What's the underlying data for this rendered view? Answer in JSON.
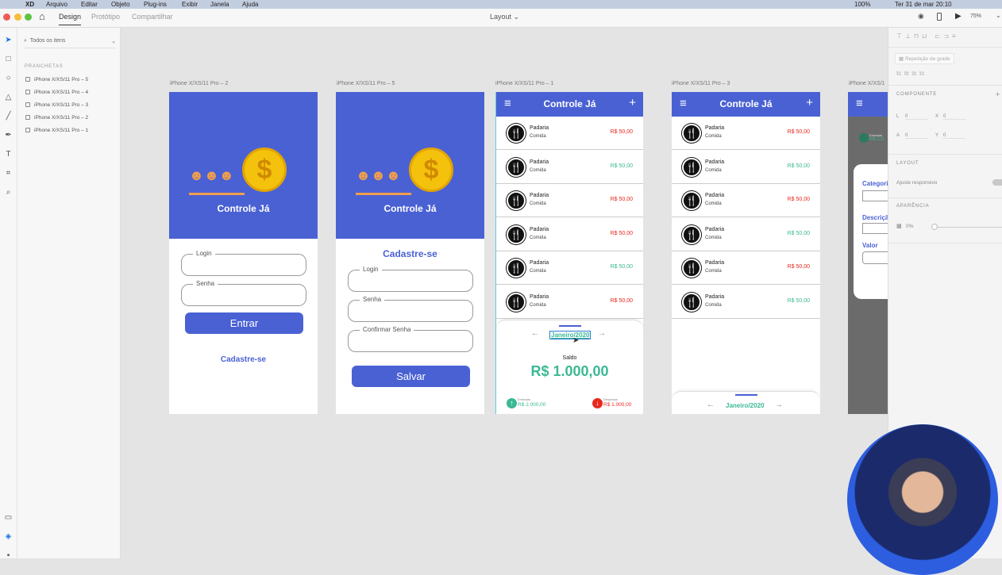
{
  "menubar": {
    "items": [
      "XD",
      "Arquivo",
      "Editar",
      "Objeto",
      "Plug-ins",
      "Exibir",
      "Janela",
      "Ajuda"
    ],
    "battery": "100%",
    "clock": "Ter 31 de mar  20:10"
  },
  "toolbar": {
    "tabs": [
      "Design",
      "Protótipo",
      "Compartilhar"
    ],
    "doc_title": "Layout",
    "zoom": "75%"
  },
  "layers": {
    "search_placeholder": "Todos os itens",
    "section": "PRANCHETAS",
    "items": [
      "iPhone X/XS/11 Pro – 5",
      "iPhone X/XS/11 Pro – 4",
      "iPhone X/XS/11 Pro – 3",
      "iPhone X/XS/11 Pro – 2",
      "iPhone X/XS/11 Pro – 1"
    ]
  },
  "artboards": {
    "login": {
      "label": "iPhone X/XS/11 Pro – 2",
      "title": "Controle Já",
      "login": "Login",
      "senha": "Senha",
      "entrar": "Entrar",
      "cadastre": "Cadastre-se"
    },
    "signup": {
      "label": "iPhone X/XS/11 Pro – 5",
      "title": "Controle Já",
      "heading": "Cadastre-se",
      "login": "Login",
      "senha": "Senha",
      "confirmar": "Confirmar Senha",
      "salvar": "Salvar"
    },
    "list1": {
      "label": "iPhone X/XS/11 Pro – 1",
      "title": "Controle Já",
      "month": "Janeiro/2020",
      "saldo_label": "Saldo",
      "saldo": "R$ 1.000,00",
      "entradas_label": "Entradas",
      "entradas": "R$ 2.000,00",
      "despesas_label": "Despesas",
      "despesas": "R$ 1.000,00",
      "rows": [
        {
          "name": "Padaria",
          "cat": "Comida",
          "amount": "R$ 50,00",
          "type": "out"
        },
        {
          "name": "Padaria",
          "cat": "Comida",
          "amount": "R$ 50,00",
          "type": "in"
        },
        {
          "name": "Padaria",
          "cat": "Comida",
          "amount": "R$ 50,00",
          "type": "out"
        },
        {
          "name": "Padaria",
          "cat": "Comida",
          "amount": "R$ 50,00",
          "type": "out"
        },
        {
          "name": "Padaria",
          "cat": "Comida",
          "amount": "R$ 50,00",
          "type": "in"
        },
        {
          "name": "Padaria",
          "cat": "Comida",
          "amount": "R$ 50,00",
          "type": "out"
        }
      ]
    },
    "list3": {
      "label": "iPhone X/XS/11 Pro – 3",
      "title": "Controle Já",
      "month": "Janeiro/2020",
      "rows": [
        {
          "name": "Padaria",
          "cat": "Comida",
          "amount": "R$ 50,00",
          "type": "out"
        },
        {
          "name": "Padaria",
          "cat": "Comida",
          "amount": "R$ 50,00",
          "type": "in"
        },
        {
          "name": "Padaria",
          "cat": "Comida",
          "amount": "R$ 50,00",
          "type": "out"
        },
        {
          "name": "Padaria",
          "cat": "Comida",
          "amount": "R$ 50,00",
          "type": "in"
        },
        {
          "name": "Padaria",
          "cat": "Comida",
          "amount": "R$ 50,00",
          "type": "out"
        },
        {
          "name": "Padaria",
          "cat": "Comida",
          "amount": "R$ 50,00",
          "type": "in"
        }
      ]
    },
    "form4": {
      "label": "iPhone X/XS/1",
      "categoria": "Categori",
      "descricao": "Descriçã",
      "valor": "Valor",
      "entradas_label": "Entradas",
      "entradas": "R$ 2.0"
    }
  },
  "right_panel": {
    "grid_repeat": "Repetição de grade",
    "componente": "COMPONENTE",
    "l": "L",
    "l_val": "0",
    "x": "X",
    "x_val": "0",
    "a": "A",
    "a_val": "0",
    "y": "Y",
    "y_val": "0",
    "layout": "LAYOUT",
    "responsive": "Ajuste responsivo",
    "aparencia": "APARÊNCIA",
    "opacity": "0%"
  },
  "colors": {
    "brand": "#4a61d4",
    "income": "#3bb894",
    "expense": "#e8281e"
  }
}
